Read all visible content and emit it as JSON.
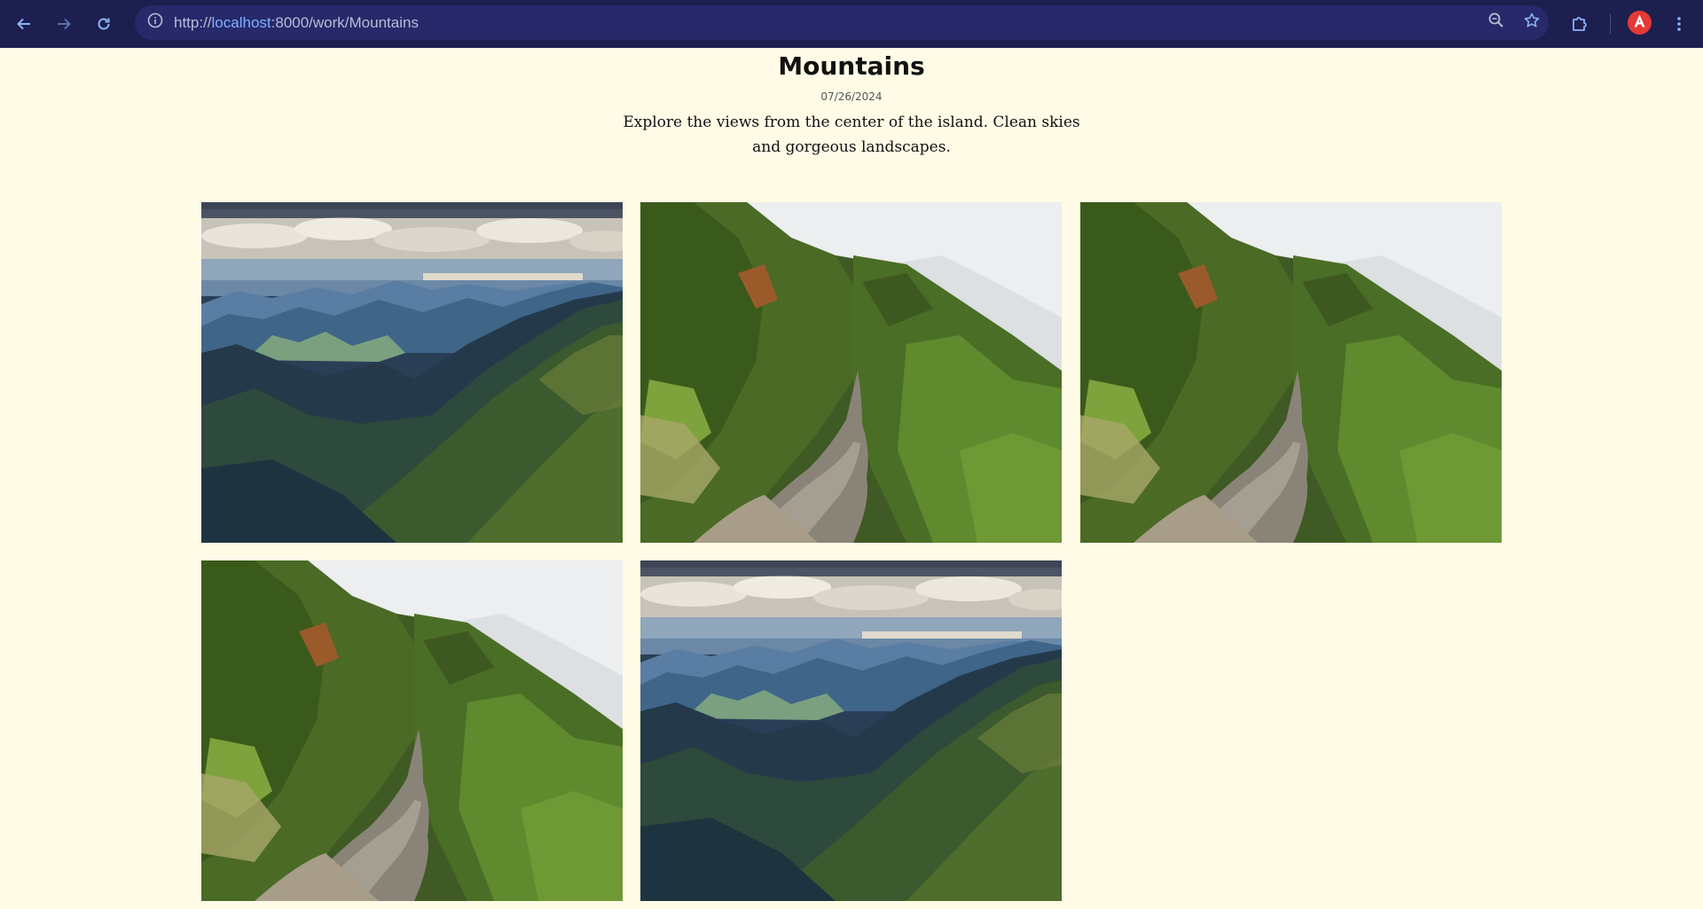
{
  "browser": {
    "url_scheme": "http://",
    "url_host": "localhost",
    "url_rest": ":8000/work/Mountains",
    "icons": {
      "back": "arrow-left-icon",
      "forward": "arrow-right-icon",
      "reload": "reload-icon",
      "site_info": "info-icon",
      "zoom": "zoom-icon",
      "bookmark": "star-icon",
      "extensions": "puzzle-icon",
      "profile": "profile-avatar-icon",
      "menu": "kebab-menu-icon"
    },
    "colors": {
      "toolbar": "#1d1f4f",
      "omnibox": "#27296a",
      "accent": "#7fb2ff",
      "avatar": "#e53935"
    }
  },
  "page": {
    "title": "Mountains",
    "date": "07/26/2024",
    "description": "Explore the views from the center of the island. Clean skies and gorgeous landscapes.",
    "background": "#fffbe6",
    "gallery": [
      {
        "scene": "ocean-view-mountains"
      },
      {
        "scene": "misty-trail"
      },
      {
        "scene": "misty-trail"
      },
      {
        "scene": "misty-trail"
      },
      {
        "scene": "ocean-view-mountains"
      }
    ]
  }
}
